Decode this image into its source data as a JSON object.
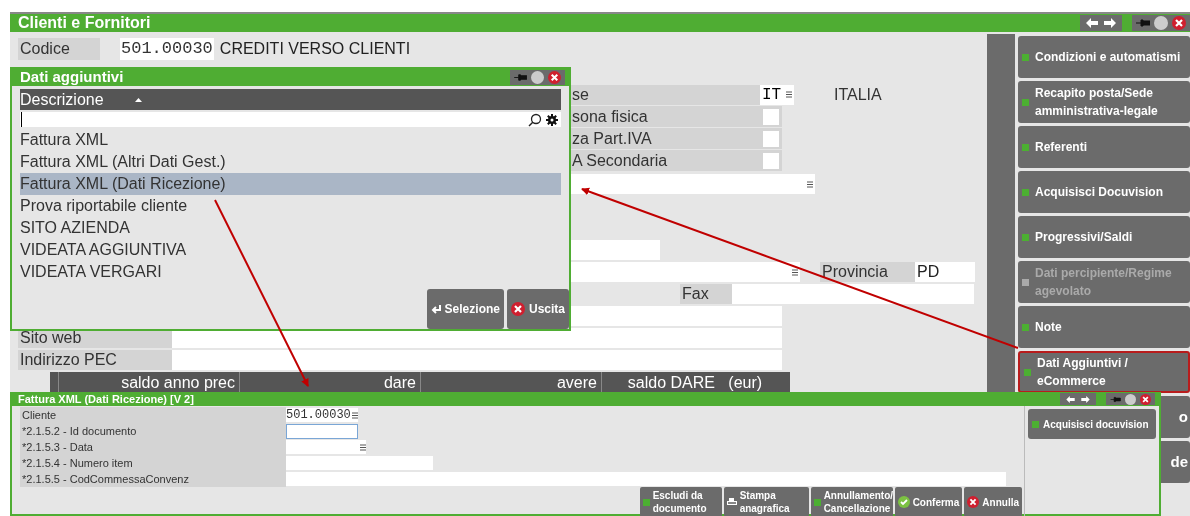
{
  "main_window": {
    "title": "Clienti e Fornitori",
    "codice": {
      "label": "Codice",
      "value": "501.00030",
      "description": "CREDITI VERSO CLIENTI"
    },
    "upper_rows": [
      {
        "kind": "lookup",
        "label": "se",
        "value": "IT",
        "description": "ITALIA"
      },
      {
        "kind": "checkbox",
        "label": "sona fisica",
        "checked": false
      },
      {
        "kind": "checkbox",
        "label": "za Part.IVA",
        "checked": false
      },
      {
        "kind": "checkbox",
        "label": "A Secondaria",
        "checked": false
      },
      {
        "kind": "lookup_field"
      }
    ],
    "provincia": {
      "label": "Provincia",
      "value": "PD"
    },
    "fax": {
      "label": "Fax"
    },
    "sito_web": {
      "label": "Sito web"
    },
    "pec": {
      "label": "Indirizzo PEC"
    },
    "table_columns": [
      "saldo anno prec",
      "dare",
      "avere",
      "saldo DARE   (eur)"
    ],
    "side_buttons": [
      {
        "label": "Condizioni e automatismi",
        "disabled": false,
        "selected": false
      },
      {
        "label": "Recapito posta/Sede amministrativa-legale",
        "disabled": false,
        "selected": false
      },
      {
        "label": "Referenti",
        "disabled": false,
        "selected": false
      },
      {
        "label": "Acquisisci Docuvision",
        "disabled": false,
        "selected": false
      },
      {
        "label": "Progressivi/Saldi",
        "disabled": false,
        "selected": false
      },
      {
        "label": "Dati percipiente/Regime agevolato",
        "disabled": true,
        "selected": false
      },
      {
        "label": "Note",
        "disabled": false,
        "selected": false
      },
      {
        "label": "Dati Aggiuntivi / eCommerce",
        "disabled": false,
        "selected": true
      }
    ],
    "hidden_buttons": [
      "o",
      "de"
    ]
  },
  "dialog": {
    "title": "Dati aggiuntivi",
    "column": "Descrizione",
    "items": [
      {
        "label": "Fattura XML",
        "selected": false
      },
      {
        "label": "Fattura XML (Altri Dati Gest.)",
        "selected": false
      },
      {
        "label": "Fattura XML (Dati Ricezione)",
        "selected": true
      },
      {
        "label": "Prova riportabile cliente",
        "selected": false
      },
      {
        "label": "SITO AZIENDA",
        "selected": false
      },
      {
        "label": "VIDEATA AGGIUNTIVA",
        "selected": false
      },
      {
        "label": "VIDEATA VERGARI",
        "selected": false
      }
    ],
    "buttons": [
      {
        "label": "Selezione",
        "kind": "enter"
      },
      {
        "label": "Uscita",
        "kind": "close"
      }
    ]
  },
  "form_window": {
    "title": "Fattura XML (Dati Ricezione) [V 2]",
    "fields": [
      {
        "kind": "code",
        "label": "Cliente",
        "value": "501.00030"
      },
      {
        "kind": "focused",
        "label": "*2.1.5.2 - Id documento"
      },
      {
        "kind": "date",
        "label": "*2.1.5.3 - Data"
      },
      {
        "kind": "medium",
        "label": "*2.1.5.4 - Numero item"
      },
      {
        "kind": "long",
        "label": "*2.1.5.5 - CodCommessaConvenz"
      }
    ],
    "side_button": "Acquisisci docuvision",
    "buttons": [
      {
        "label": "Escludi da documento",
        "kind": "dot"
      },
      {
        "label": "Stampa anagrafica",
        "kind": "print"
      },
      {
        "label": "Annullamento/ Cancellazione",
        "kind": "dot"
      },
      {
        "label": "Conferma",
        "kind": "confirm"
      },
      {
        "label": "Annulla",
        "kind": "cancel"
      }
    ]
  }
}
